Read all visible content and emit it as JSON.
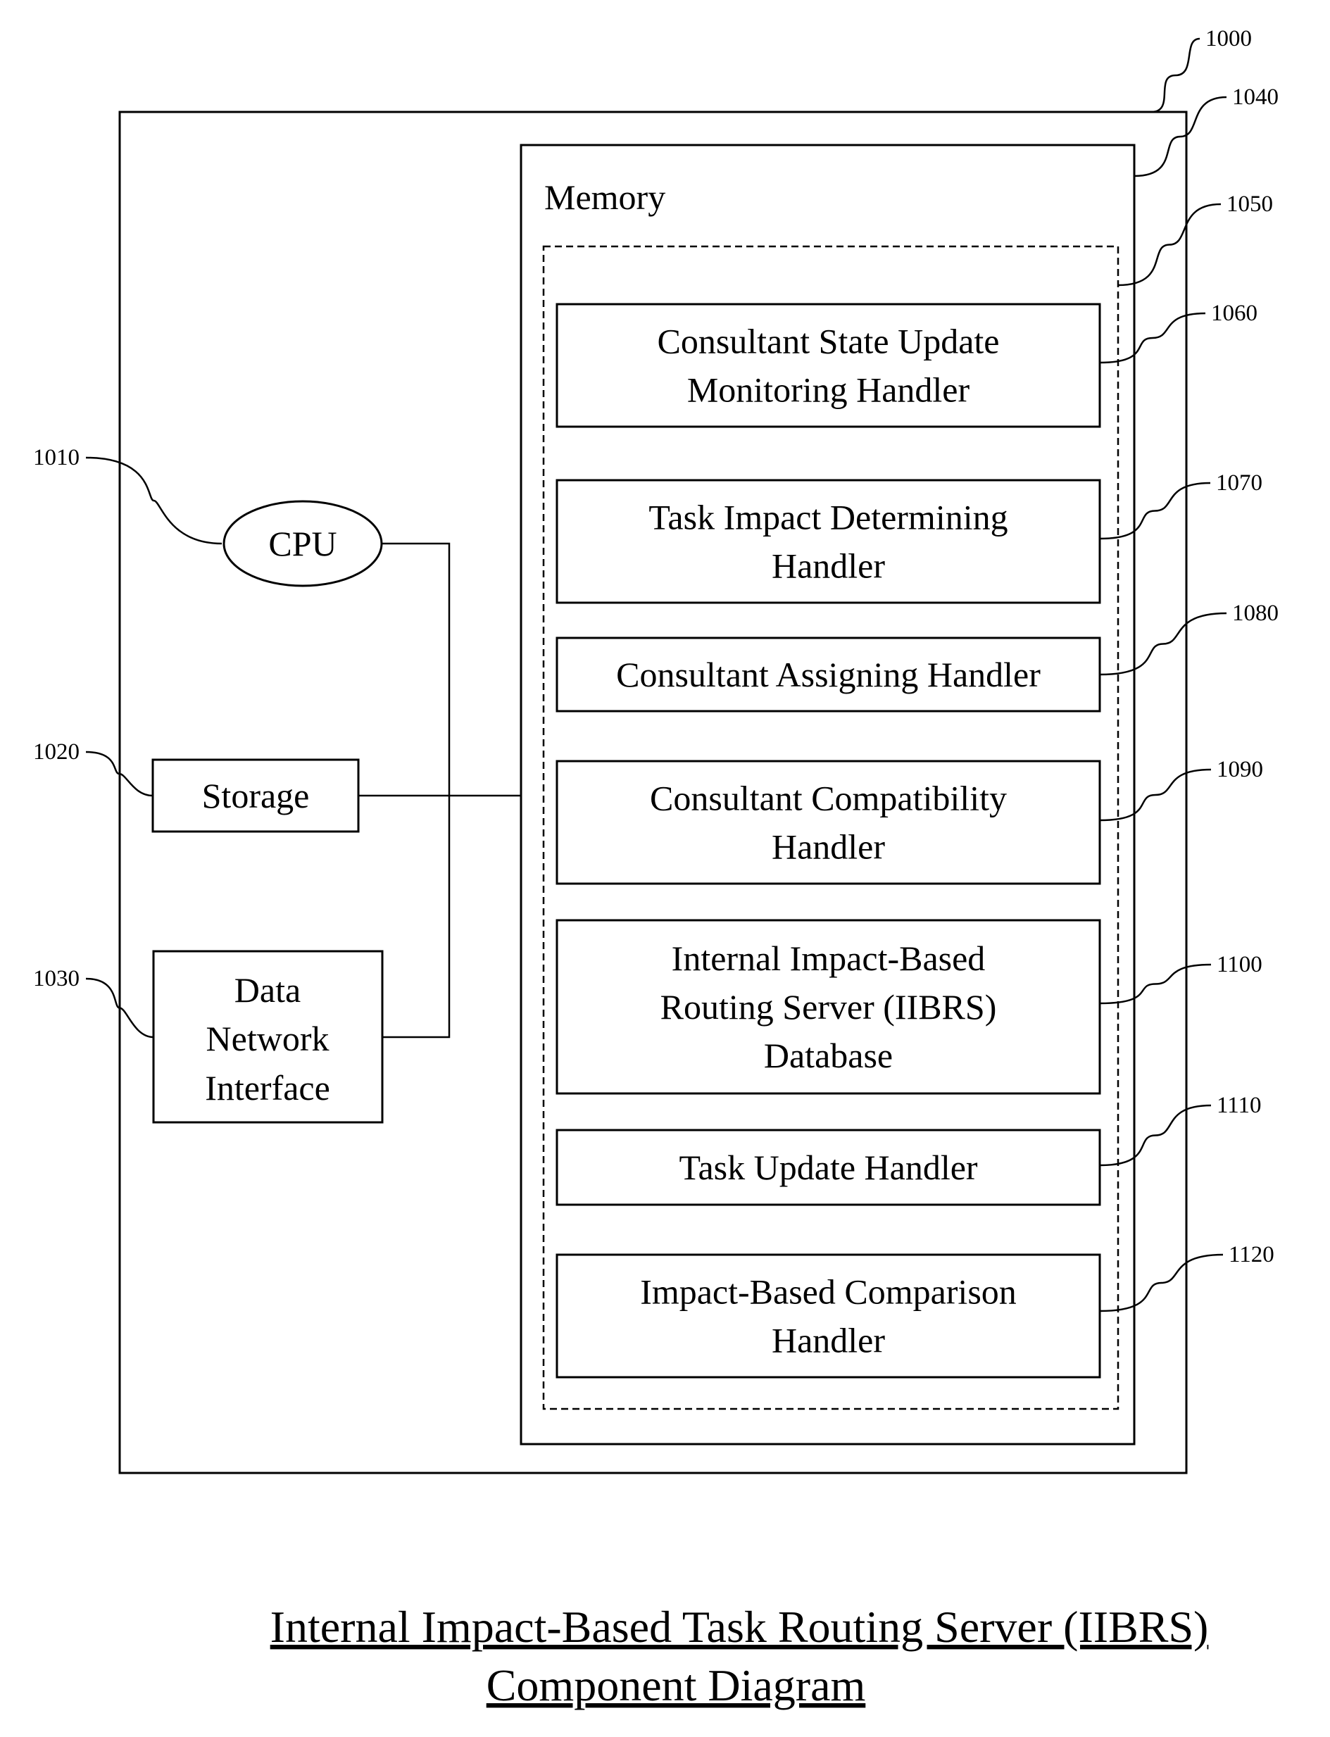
{
  "refs": {
    "server": "1000",
    "cpu": "1010",
    "storage": "1020",
    "network": "1030",
    "memory": "1040",
    "memory_block": "1050",
    "h1": "1060",
    "h2": "1070",
    "h3": "1080",
    "h4": "1090",
    "h5": "1100",
    "h6": "1110",
    "h7": "1120"
  },
  "components": {
    "cpu": "CPU",
    "storage": "Storage",
    "network": [
      "Data",
      "Network",
      "Interface"
    ],
    "memory": "Memory"
  },
  "handlers": [
    [
      "Consultant State Update",
      "Monitoring Handler"
    ],
    [
      "Task Impact Determining",
      "Handler"
    ],
    [
      "Consultant Assigning Handler"
    ],
    [
      "Consultant Compatibility",
      "Handler"
    ],
    [
      "Internal Impact-Based",
      "Routing Server (IIBRS)",
      "Database"
    ],
    [
      "Task Update Handler"
    ],
    [
      "Impact-Based Comparison",
      "Handler"
    ]
  ],
  "caption": [
    "Internal Impact-Based Task Routing Server (IIBRS)",
    "Component Diagram"
  ]
}
